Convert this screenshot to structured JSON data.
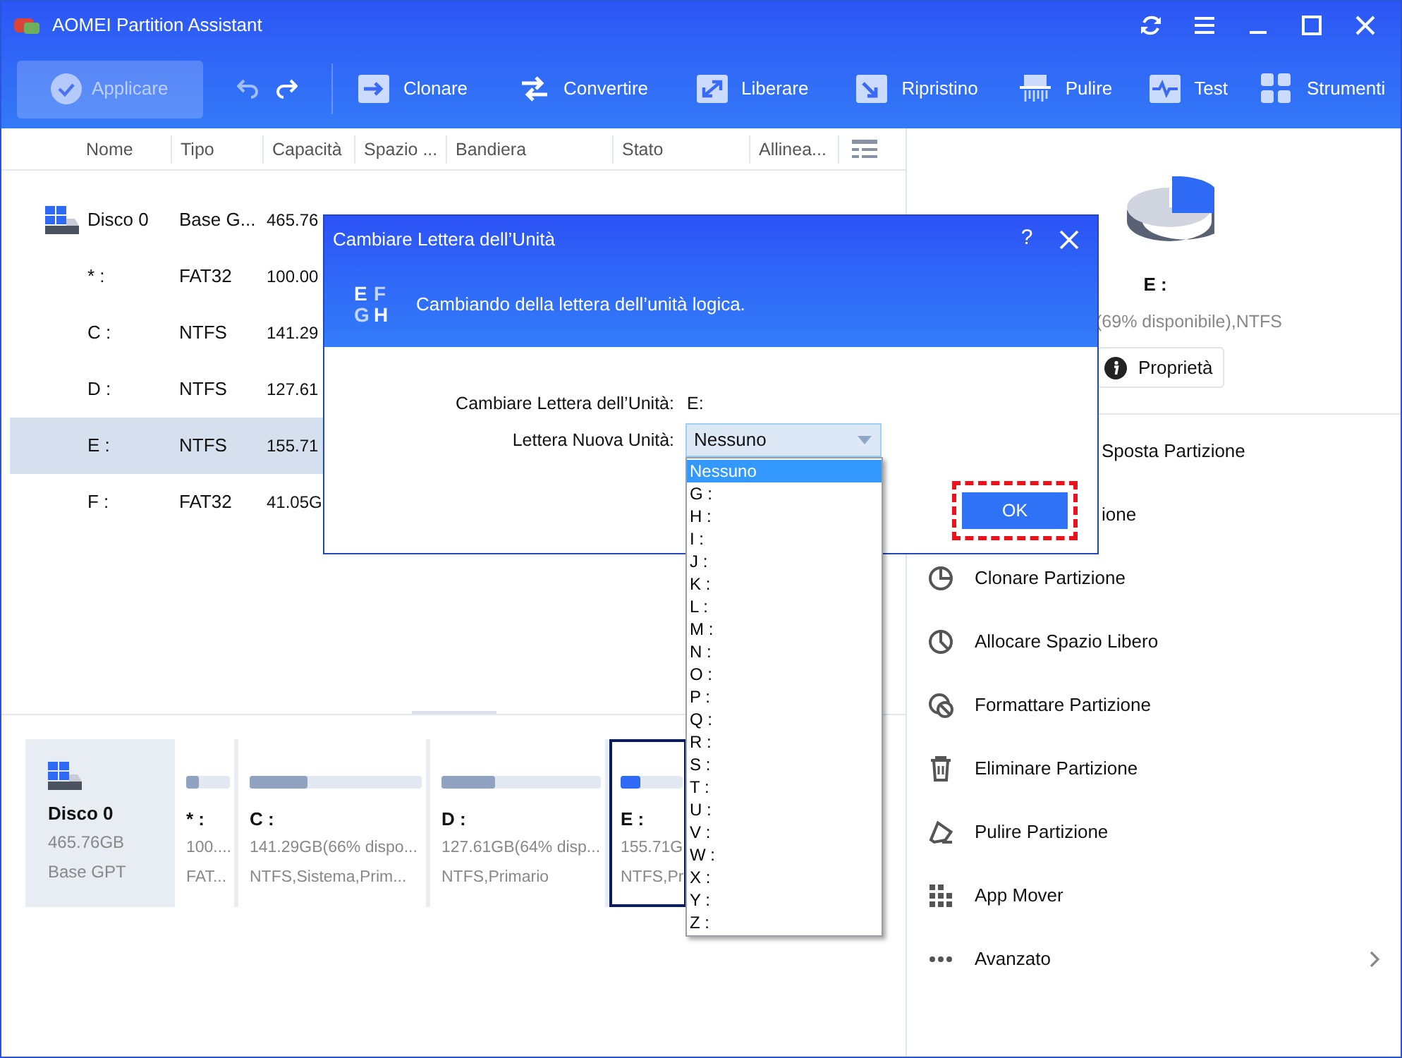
{
  "window": {
    "title": "AOMEI Partition Assistant"
  },
  "toolbar": {
    "apply_button": {
      "label": "Applicare",
      "disabled": true
    },
    "tools": [
      {
        "label": "Clonare"
      },
      {
        "label": "Convertire"
      },
      {
        "label": "Liberare"
      },
      {
        "label": "Ripristino"
      },
      {
        "label": "Pulire"
      },
      {
        "label": "Test"
      },
      {
        "label": "Strumenti"
      }
    ]
  },
  "table": {
    "columns": [
      "Nome",
      "Tipo",
      "Capacità",
      "Spazio ...",
      "Bandiera",
      "Stato",
      "Allinea..."
    ],
    "rows": [
      {
        "kind": "disk",
        "name": "Disco 0",
        "type": "Base G...",
        "capacity": "465.76",
        "selected": false
      },
      {
        "kind": "partition",
        "name": "* :",
        "type": "FAT32",
        "capacity": "100.00",
        "selected": false
      },
      {
        "kind": "partition",
        "name": "C :",
        "type": "NTFS",
        "capacity": "141.29",
        "selected": false
      },
      {
        "kind": "partition",
        "name": "D :",
        "type": "NTFS",
        "capacity": "127.61",
        "selected": false
      },
      {
        "kind": "partition",
        "name": "E :",
        "type": "NTFS",
        "capacity": "155.71",
        "selected": true
      },
      {
        "kind": "partition",
        "name": "F :",
        "type": "FAT32",
        "capacity": "41.05G",
        "selected": false
      }
    ]
  },
  "disk_map": {
    "disk": {
      "name": "Disco 0",
      "size": "465.76GB",
      "type": "Base GPT"
    },
    "partitions": [
      {
        "letter": "* :",
        "size": "100....",
        "info": "FAT...",
        "level": 0.3,
        "selected": false
      },
      {
        "letter": "C :",
        "size": "141.29GB(66% dispo...",
        "info": "NTFS,Sistema,Prim...",
        "level": 0.34,
        "selected": false
      },
      {
        "letter": "D :",
        "size": "127.61GB(64% disp...",
        "info": "NTFS,Primario",
        "level": 0.34,
        "selected": false
      },
      {
        "letter": "E :",
        "size": "155.71G",
        "info": "NTFS,Pr",
        "level": 0.31,
        "selected": true
      }
    ]
  },
  "right_panel": {
    "partition": "E :",
    "details": "(69% disponibile),NTFS",
    "properties_button": "Proprietà",
    "actions": [
      {
        "label": "Sposta Partizione",
        "covered": true
      },
      {
        "label": "ione",
        "covered": true
      },
      {
        "label": "Clonare Partizione",
        "covered": false
      },
      {
        "label": "Allocare Spazio Libero",
        "covered": false
      },
      {
        "label": "Formattare Partizione",
        "covered": false
      },
      {
        "label": "Eliminare Partizione",
        "covered": false
      },
      {
        "label": "Pulire Partizione",
        "covered": false
      },
      {
        "label": "App Mover",
        "covered": false
      },
      {
        "label": "Avanzato",
        "covered": false
      }
    ]
  },
  "dialog": {
    "title": "Cambiare Lettera dell’Unità",
    "help": "?",
    "logo_letters": [
      "E",
      "F",
      "G",
      "H"
    ],
    "subtitle": "Cambiando della lettera dell’unità logica.",
    "current": {
      "label": "Cambiare Lettera dell’Unità:",
      "value": "E:"
    },
    "new_letter": {
      "label": "Lettera Nuova Unità:",
      "value": "Nessuno",
      "open": true
    },
    "options": [
      {
        "label": "Nessuno",
        "selected": true
      },
      {
        "label": "G :",
        "selected": false
      },
      {
        "label": "H :",
        "selected": false
      },
      {
        "label": "I :",
        "selected": false
      },
      {
        "label": "J :",
        "selected": false
      },
      {
        "label": "K :",
        "selected": false
      },
      {
        "label": "L :",
        "selected": false
      },
      {
        "label": "M :",
        "selected": false
      },
      {
        "label": "N :",
        "selected": false
      },
      {
        "label": "O :",
        "selected": false
      },
      {
        "label": "P :",
        "selected": false
      },
      {
        "label": "Q :",
        "selected": false
      },
      {
        "label": "R :",
        "selected": false
      },
      {
        "label": "S :",
        "selected": false
      },
      {
        "label": "T :",
        "selected": false
      },
      {
        "label": "U :",
        "selected": false
      },
      {
        "label": "V :",
        "selected": false
      },
      {
        "label": "W :",
        "selected": false
      },
      {
        "label": "X :",
        "selected": false
      },
      {
        "label": "Y :",
        "selected": false
      },
      {
        "label": "Z :",
        "selected": false
      }
    ],
    "ok_button": {
      "label": "OK",
      "highlighted": true
    }
  }
}
